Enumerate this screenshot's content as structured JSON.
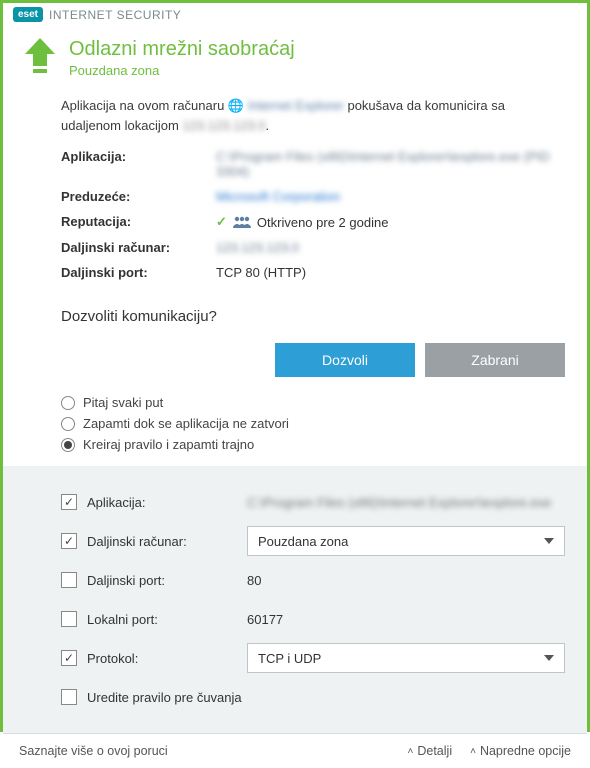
{
  "titlebar": {
    "brand": "eset",
    "product": "INTERNET SECURITY"
  },
  "header": {
    "title": "Odlazni mrežni saobraćaj",
    "subtitle": "Pouzdana zona"
  },
  "intro": {
    "prefix": "Aplikacija na ovom računaru ",
    "app_link": "Internet Explorer",
    "mid": " pokušava da komunicira sa udaljenom lokacijom ",
    "target": "123.123.123.0"
  },
  "details": {
    "app_label": "Aplikacija:",
    "app_value": "C:\\Program Files (x86)\\Internet Explorer\\iexplore.exe (PID 3304)",
    "company_label": "Preduzeće:",
    "company_value": "Microsoft Corporation",
    "reputation_label": "Reputacija:",
    "reputation_value": "Otkriveno pre 2 godine",
    "remote_label": "Daljinski računar:",
    "remote_value": "123.123.123.0",
    "port_label": "Daljinski port:",
    "port_value": "TCP 80 (HTTP)"
  },
  "question": "Dozvoliti komunikaciju?",
  "buttons": {
    "allow": "Dozvoli",
    "deny": "Zabrani"
  },
  "radios": {
    "ask": "Pitaj svaki put",
    "remember_close": "Zapamti dok se aplikacija ne zatvori",
    "create_rule": "Kreiraj pravilo i zapamti trajno",
    "selected": "create_rule"
  },
  "rule": {
    "app_label": "Aplikacija:",
    "app_value": "C:\\Program Files (x86)\\Internet Explorer\\iexplore.exe",
    "remote_label": "Daljinski računar:",
    "remote_value": "Pouzdana zona",
    "rport_label": "Daljinski port:",
    "rport_value": "80",
    "lport_label": "Lokalni port:",
    "lport_value": "60177",
    "proto_label": "Protokol:",
    "proto_value": "TCP i UDP",
    "edit_label": "Uredite pravilo pre čuvanja"
  },
  "footer": {
    "learn": "Saznajte više o ovoj poruci",
    "details": "Detalji",
    "advanced": "Napredne opcije"
  }
}
